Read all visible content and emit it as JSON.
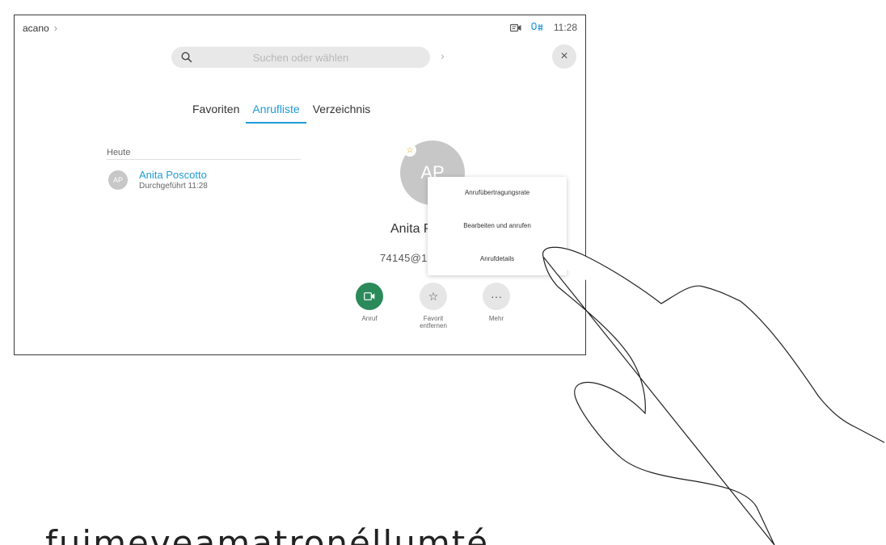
{
  "topbar": {
    "breadcrumb": "acano",
    "breadcrumb_chevron": "›",
    "time": "11:28"
  },
  "search": {
    "placeholder": "Suchen oder wählen",
    "chevron": "›",
    "close_label": "×"
  },
  "tabs": [
    {
      "label": "Favoriten",
      "active": false
    },
    {
      "label": "Anrufliste",
      "active": true
    },
    {
      "label": "Verzeichnis",
      "active": false
    }
  ],
  "history": {
    "section": "Heute",
    "items": [
      {
        "initials": "AP",
        "name": "Anita Poscotto",
        "detail": "Durchgeführt 11:28"
      }
    ]
  },
  "contact": {
    "initials": "AP",
    "name_visible": "Anita P",
    "number_visible": "74145@1",
    "favorite_glyph": "☆"
  },
  "menu": {
    "items": [
      {
        "label": "Anrufübertragungsrate"
      },
      {
        "label": "Bearbeiten und anrufen"
      },
      {
        "label": "Anrufdetails"
      }
    ]
  },
  "actions": {
    "call": {
      "label": "Anruf"
    },
    "favorite": {
      "label_line1": "Favorit",
      "label_line2": "entfernen",
      "glyph": "☆"
    },
    "more": {
      "label": "Mehr",
      "glyph": "···"
    }
  },
  "caption": {
    "text": "fuimeveamatronéllumté"
  },
  "colors": {
    "accent": "#1e9bd6",
    "call_green": "#2a8a5a",
    "avatar_grey": "#c7c7c7",
    "star_yellow": "#e3a100"
  }
}
